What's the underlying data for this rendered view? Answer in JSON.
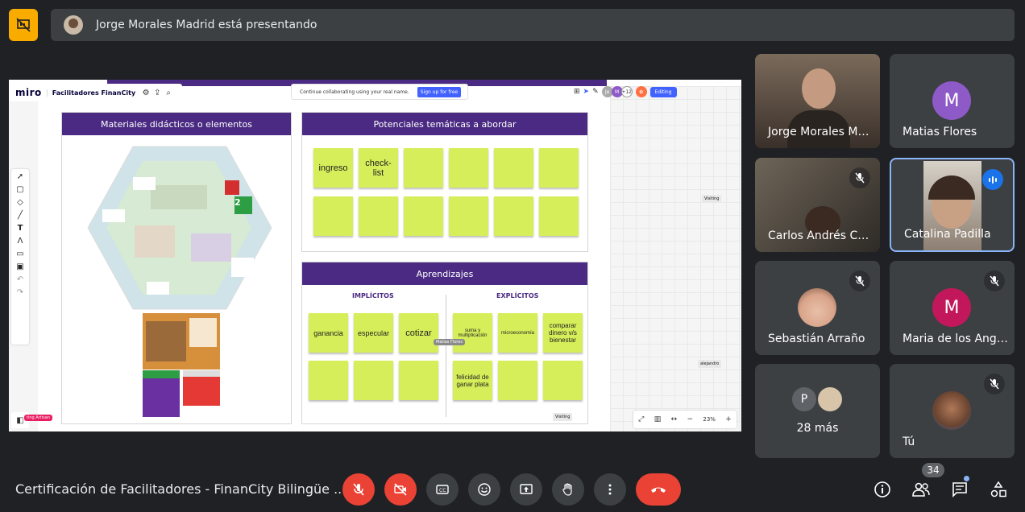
{
  "presenter_banner": {
    "text": "Jorge Morales Madrid está presentando"
  },
  "miro": {
    "logo": "miro",
    "board_name": "Facilitadores FinanCity",
    "collab_text": "Continue collaborating using your real name.",
    "collab_button": "Sign up for free",
    "avatar_count": "+12",
    "editing_label": "Editing",
    "visiting_label": "Visiting",
    "cursor_alejandro": "alejandro",
    "cursor_matias": "Matias Flores",
    "cursor_artisan": "ting Artisan",
    "zoom_level": "23%"
  },
  "board": {
    "panel_materiales": "Materiales didácticos o elementos",
    "panel_potenciales": "Potenciales temáticas a abordar",
    "panel_aprendizajes": "Aprendizajes",
    "implicitos": "IMPLÍCITOS",
    "explicitos": "EXPLÍCITOS",
    "stickies_potenciales": [
      "ingreso",
      "check-\nlist"
    ],
    "stickies_implicitos": [
      "ganancia",
      "especular",
      "cotizar"
    ],
    "stickies_explicitos": [
      "suma y multiplicación",
      "microeconomía",
      "comparar dinero v/s bienestar",
      "felicidad de ganar plata"
    ],
    "map_badge": "2"
  },
  "participants": [
    {
      "name": "Jorge Morales M…",
      "type": "video"
    },
    {
      "name": "Matias Flores",
      "initial": "M",
      "color": "#8e5ac8"
    },
    {
      "name": "Carlos Andrés C…",
      "type": "video",
      "muted": true
    },
    {
      "name": "Catalina Padilla",
      "type": "video",
      "speaking": true
    },
    {
      "name": "Sebastián Arraño",
      "type": "photo",
      "muted": true
    },
    {
      "name": "Maria de los Ang…",
      "initial": "M",
      "color": "#c2185b",
      "muted": true
    },
    {
      "name": "28 más",
      "initial": "P",
      "color": "#5f6368"
    },
    {
      "name": "Tú",
      "type": "photo",
      "muted": true
    }
  ],
  "bottom": {
    "meeting_title": "Certificación de Facilitadores - FinanCity Bilingüe ...",
    "people_count": "34"
  },
  "colors": {
    "accent_red": "#ea4335",
    "warning": "#f9ab00",
    "speaking_blue": "#1a73e8",
    "board_purple": "#4a2a82",
    "sticky": "#d6ee5a"
  }
}
